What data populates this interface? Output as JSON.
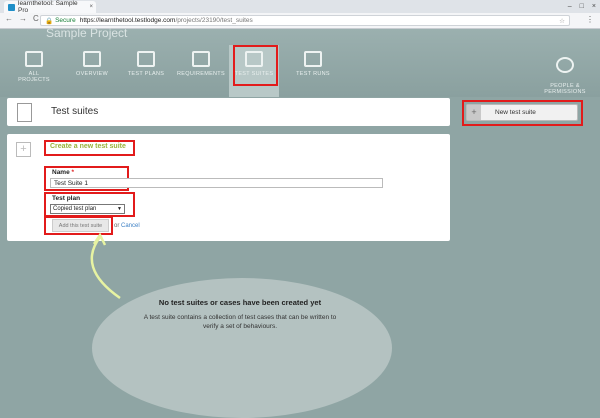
{
  "browser": {
    "tab_title": "learnthetool: Sample Pro",
    "tab_close": "×",
    "window_controls": [
      "–",
      "□",
      "×"
    ],
    "nav": [
      "←",
      "→",
      "C"
    ],
    "secure_label": "Secure",
    "url_host": "https://learnthetool.testlodge.com",
    "url_path": "/projects/23190/test_suites",
    "star": "☆",
    "menu": "⋮"
  },
  "app": {
    "project_title": "Sample Project",
    "nav": [
      {
        "label": "ALL PROJECTS",
        "icon": "folder-icon"
      },
      {
        "label": "OVERVIEW",
        "icon": "overview-icon"
      },
      {
        "label": "TEST PLANS",
        "icon": "pencil-document-icon"
      },
      {
        "label": "REQUIREMENTS",
        "icon": "requirements-icon"
      },
      {
        "label": "TEST SUITES",
        "icon": "test-suites-icon"
      },
      {
        "label": "TEST RUNS",
        "icon": "test-runs-icon"
      },
      {
        "label": "PEOPLE &\nPERMISSIONS",
        "icon": "people-icon"
      }
    ]
  },
  "suites": {
    "title": "Test suites",
    "new_button": "New test suite",
    "new_button_icon": "+"
  },
  "form": {
    "add_icon": "+",
    "create_title": "Create a new test suite",
    "name_label": "Name",
    "required_mark": "*",
    "name_value": "Test Suite 1",
    "plan_label": "Test plan",
    "plan_value": "Copied test plan",
    "plan_arrow": "▼",
    "submit": "Add this test suite",
    "or_text": "or",
    "cancel": "Cancel"
  },
  "empty": {
    "title": "No test suites or cases have been created yet",
    "description": "A test suite contains a collection of test cases that can be written to verify a set of behaviours."
  },
  "colors": {
    "highlight": "#e21b1b",
    "create_title": "#9ab23a",
    "link": "#3b7fc4"
  }
}
